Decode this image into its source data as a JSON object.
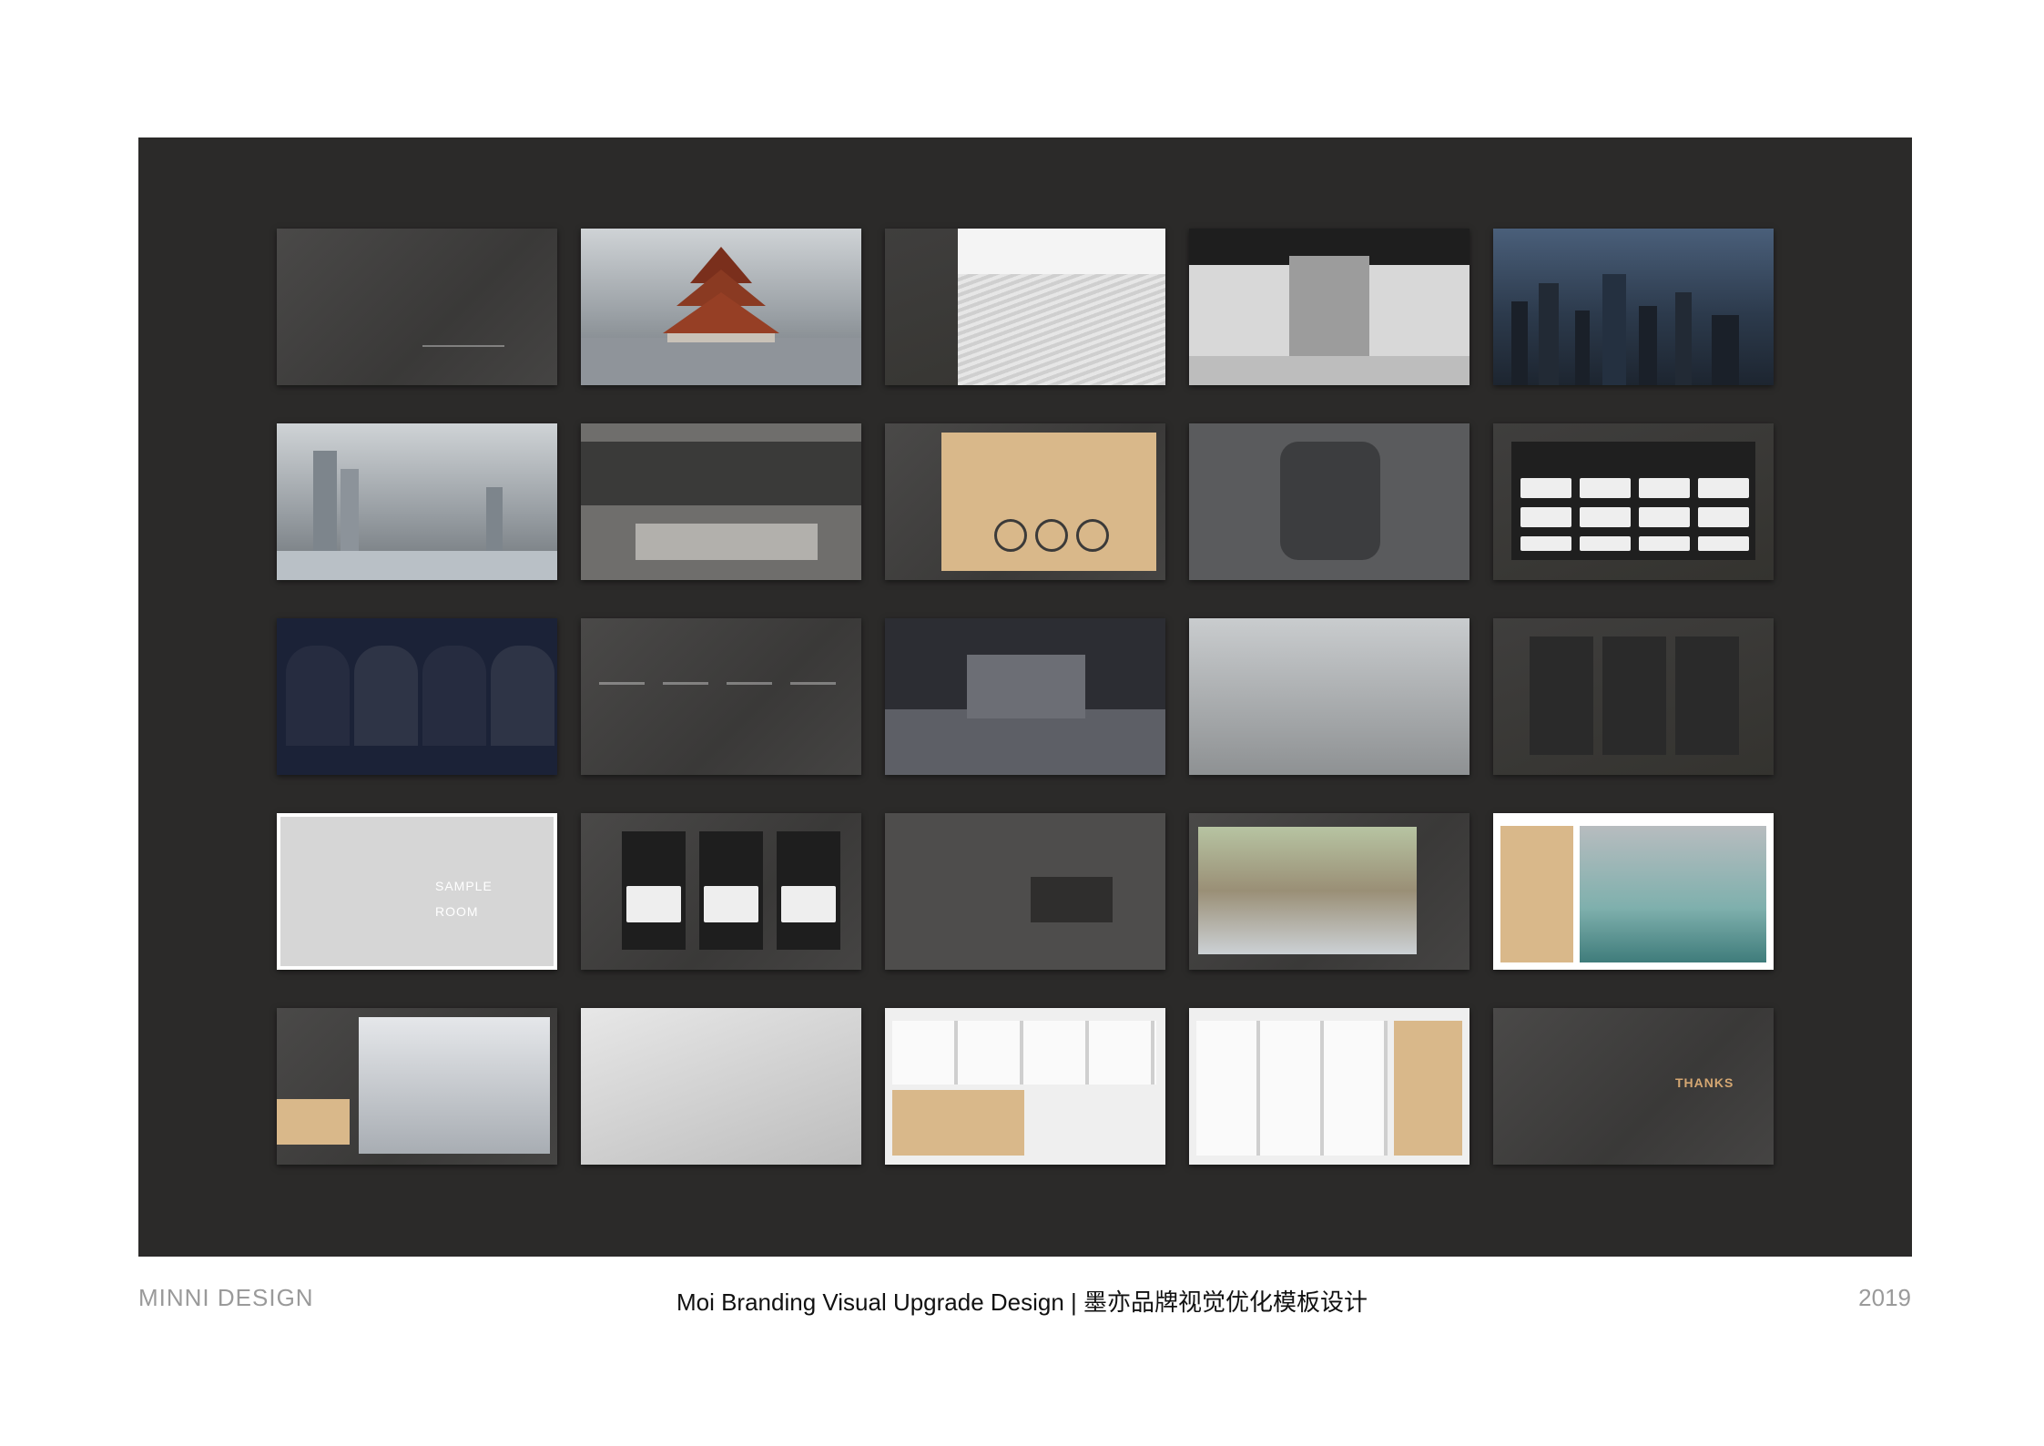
{
  "footer": {
    "left": "MINNI DESIGN",
    "center": "Moi Branding Visual Upgrade Design | 墨亦品牌视觉优化模板设计",
    "right": "2019"
  },
  "slides": {
    "sample_room_line1": "SAMPLE",
    "sample_room_line2": "ROOM",
    "thanks": "THANKS"
  },
  "colors": {
    "board": "#2b2a29",
    "accent_tan": "#d9b88a",
    "accent_copper": "#d5a772"
  }
}
